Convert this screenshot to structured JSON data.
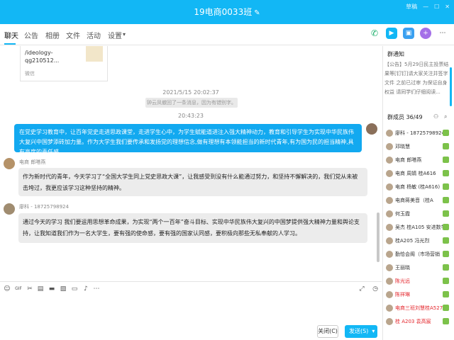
{
  "window": {
    "title": "19电商0033班",
    "top_right": "草稿"
  },
  "tabs": [
    {
      "label": "聊天"
    },
    {
      "label": "公告"
    },
    {
      "label": "相册"
    },
    {
      "label": "文件"
    },
    {
      "label": "活动"
    },
    {
      "label": "设置"
    }
  ],
  "chat": {
    "card": {
      "link": "/ideology-qg210512...",
      "source": "微信"
    },
    "timestamp1": "2021/5/15 20:02:37",
    "recall_notice": "钟云凤撤回了一条消息，因为有错别字。",
    "timestamp2": "20:43:23",
    "msg_right": "在党史学习教育中，让百年党史走进思政课堂，走进学生心中，为学生赋能道进注入强大精神动力，教育和引导学生为实现中华民族伟大复兴中国梦添砖加力量。作为大学生我们要传承和发扬党的理想信念,做有理想有本领能担当的新时代青年,有为国为民的担当精神,具有高度的责任感",
    "msg1_sender": "电商  郎嗒燕",
    "msg1_text": "作为新时代的青年，今天学习了“全国大学生同上党史思政大课”，让我感受到没有什么能通过努力，和坚持不懈解决的，我们党从未被击垮过，我更应该学习这种坚持的精神。",
    "msg2_sender": "廖科 - 18725798924",
    "msg2_text": "通过今天的学习 我们要运用思想革命成果，为实现“两个一百年”奋斗目标、实现中华民族伟大复兴的中国梦提供强大精神力量和舆论支持，让我知道我们作为一名大学生，要有强的使命感，要有强的国家认同感，要积极向那些无私奉献的人学习。"
  },
  "buttons": {
    "close": "关闭(C)",
    "send": "发送(S)"
  },
  "right_panel": {
    "notice_title": "群通知",
    "notice_text": "【公告】5月29日民主投票结果等[钉钉]请大家关注并签字 文件 之前已过审 为保证自身权益 请同学们仔细阅读...",
    "members_title": "群成员 36/49",
    "members": [
      {
        "name": "廖科 - 18725798924",
        "red": false
      },
      {
        "name": "邓晓慧",
        "red": false
      },
      {
        "name": "电商  郎嗒燕",
        "red": false
      },
      {
        "name": "电商 周婧 桂A616",
        "red": false
      },
      {
        "name": "电商 杨敏 (桂A616)",
        "red": false
      },
      {
        "name": "电商蒋美音（桂A",
        "red": false
      },
      {
        "name": "何玉霞",
        "red": false
      },
      {
        "name": "吴杰 桂A105 安进数学",
        "red": false
      },
      {
        "name": "桂A205 冯光烈",
        "red": false
      },
      {
        "name": "勤恰会阁（市场营销",
        "red": false
      },
      {
        "name": "王丽晓",
        "red": false
      },
      {
        "name": "陈光远",
        "red": true
      },
      {
        "name": "陈祥琳",
        "red": true
      },
      {
        "name": "电商三班刘慧桂A527",
        "red": true
      },
      {
        "name": "桂 A203 袁高宸",
        "red": true
      }
    ]
  }
}
